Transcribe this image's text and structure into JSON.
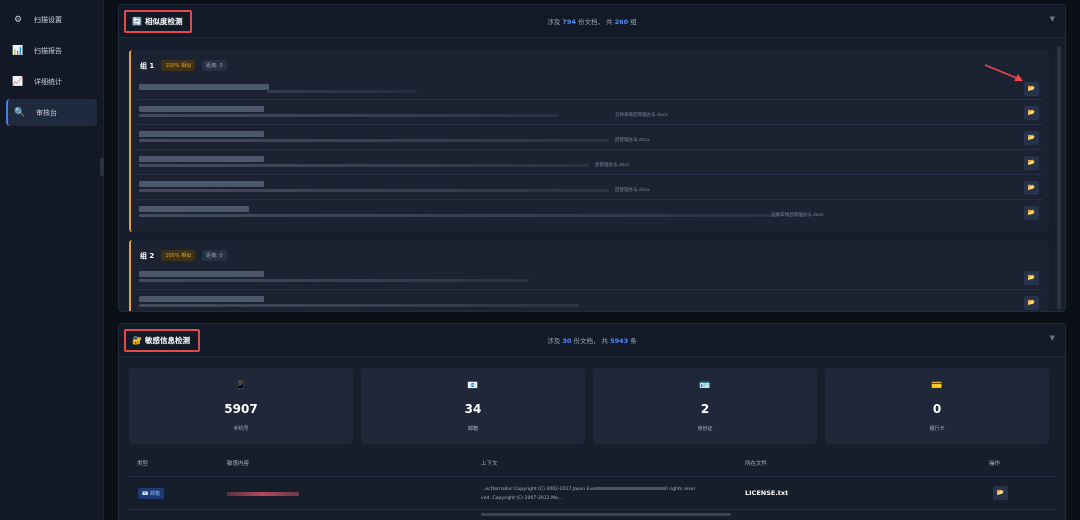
{
  "sidebar": {
    "items": [
      {
        "label": "扫描设置",
        "icon": "gear-icon",
        "glyph": "⚙"
      },
      {
        "label": "扫描报告",
        "icon": "bar-chart-icon",
        "glyph": "📊"
      },
      {
        "label": "详细统计",
        "icon": "line-chart-icon",
        "glyph": "📈"
      },
      {
        "label": "审核台",
        "icon": "magnifier-icon",
        "glyph": "🔍"
      }
    ],
    "active_index": 3
  },
  "similarity": {
    "title": "相似度检测",
    "icon_glyph": "🔄",
    "summary_prefix": "涉及",
    "doc_count": "794",
    "summary_mid": "份文档， 共",
    "group_count": "260",
    "summary_suffix": "组",
    "collapse_glyph": "▼",
    "groups": [
      {
        "name": "组 1",
        "match_badge": "100% 相似",
        "distance_badge": "距离: 0",
        "files": [
          {
            "name": ""
          },
          {
            "name": "怎样拿钱后管理办法.docx"
          },
          {
            "name": "后管理办法.docx"
          },
          {
            "name": "后管理办法.docx"
          },
          {
            "name": "后管理办法.docx"
          },
          {
            "name": "怎样拿钱后管理办法.docx"
          }
        ]
      },
      {
        "name": "组 2",
        "match_badge": "100% 相似",
        "distance_badge": "距离: 0",
        "files": [
          {
            "name": ""
          },
          {
            "name": ""
          }
        ]
      }
    ]
  },
  "sensitive": {
    "title": "敏感信息检测",
    "icon_glyph": "🔐",
    "summary_prefix": "涉及",
    "doc_count": "30",
    "summary_mid": "份文档， 共",
    "item_count": "5943",
    "summary_suffix": "条",
    "collapse_glyph": "▼",
    "stats": [
      {
        "value": "5907",
        "label": "手机号",
        "icon": "phone-icon",
        "glyph": "📱"
      },
      {
        "value": "34",
        "label": "邮箱",
        "icon": "mail-icon",
        "glyph": "📧"
      },
      {
        "value": "2",
        "label": "身份证",
        "icon": "id-card-icon",
        "glyph": "🪪"
      },
      {
        "value": "0",
        "label": "银行卡",
        "icon": "bank-card-icon",
        "glyph": "💳"
      }
    ],
    "columns": [
      "类型",
      "敏感内容",
      "上下文",
      "所在文件",
      "操作"
    ],
    "rows": [
      {
        "type": "邮箱",
        "context_line1": "...ec[ternalInc Copyright (C) 2002-2017 Jason Eve",
        "context_line1b": "ll rights reser",
        "context_line2": "ved. Copyright (C) 2007-2012 Mo...",
        "file": "LICENSE.txt"
      }
    ]
  },
  "colors": {
    "accent": "#4f8cff",
    "highlight_box": "#e5484d",
    "group_bar": "#e6a23c"
  }
}
